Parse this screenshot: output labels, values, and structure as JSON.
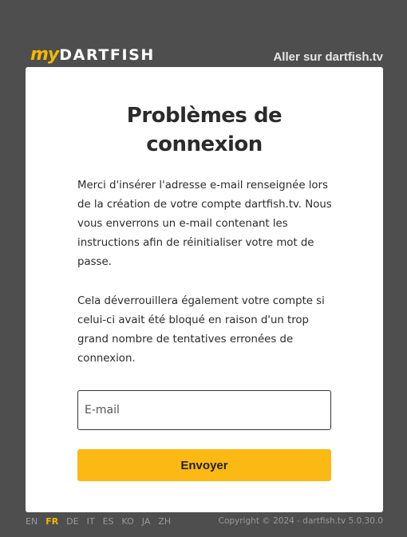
{
  "header": {
    "logo_my": "my",
    "logo_brand": "DARTFISH",
    "link_label": "Aller sur dartfish.tv"
  },
  "main": {
    "title_line1": "Problèmes de",
    "title_line2": "connexion",
    "paragraph1": "Merci d'insérer l'adresse e-mail renseignée lors de la création de votre compte dartfish.tv. Nous vous enverrons un e-mail contenant les instructions afin de réinitialiser votre mot de passe.",
    "paragraph2": "Cela déverrouillera également votre compte si celui-ci avait été bloqué en raison d'un trop grand nombre de tentatives erronées de connexion.",
    "email": {
      "placeholder": "E-mail",
      "value": ""
    },
    "submit_label": "Envoyer"
  },
  "footer": {
    "languages": [
      "EN",
      "FR",
      "DE",
      "IT",
      "ES",
      "KO",
      "JA",
      "ZH"
    ],
    "active_language": "FR",
    "copyright": "Copyright © 2024 - dartfish.tv 5.0.30.0"
  },
  "colors": {
    "background": "#4e4e4e",
    "accent": "#fcb813",
    "card": "#ffffff"
  }
}
